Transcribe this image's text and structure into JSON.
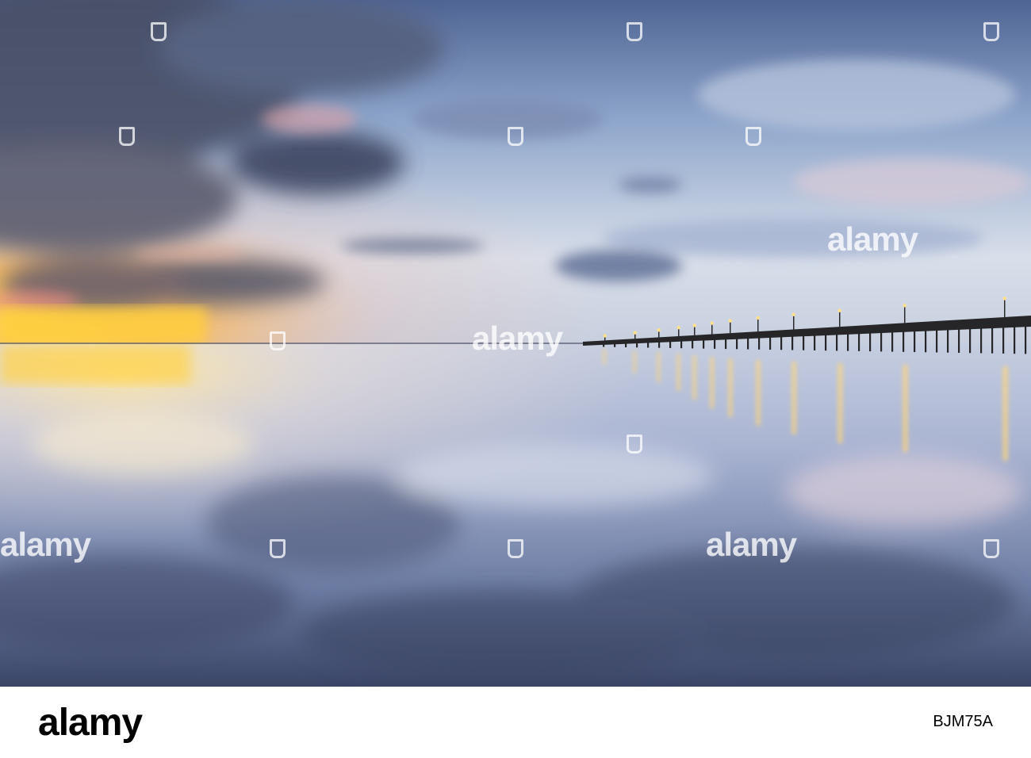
{
  "photo": {
    "subject": "seascape-at-dusk-with-pier",
    "colors": {
      "sky_top": "#5f7aa8",
      "sky_mid": "#c9d4e6",
      "horizon_glow": "#ffd24a",
      "water": "#8fa0c4",
      "water_dark": "#3c4868",
      "pier": "#2a2a2c",
      "lamp": "#ffe08a"
    }
  },
  "watermarks": {
    "text": "alamy"
  },
  "footer": {
    "logo": "alamy",
    "image_id": "BJM75A"
  }
}
